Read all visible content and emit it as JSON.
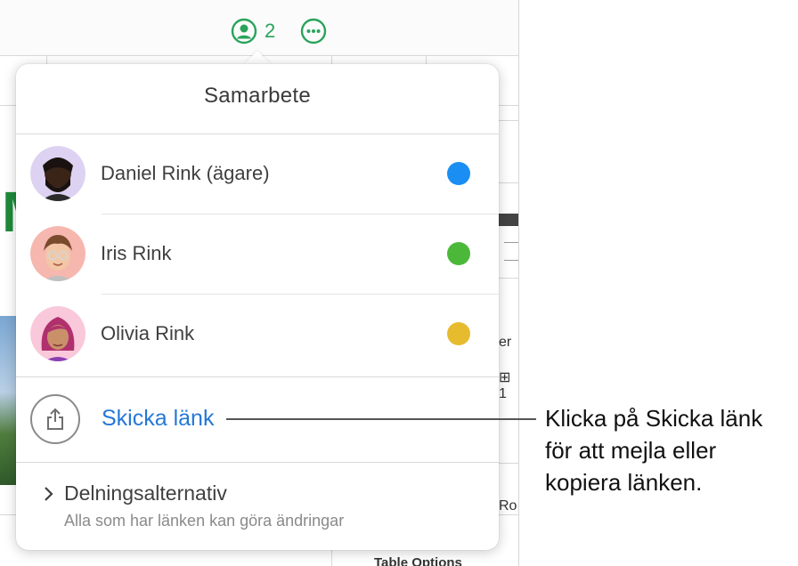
{
  "toolbar": {
    "collaborators_count": "2"
  },
  "popover": {
    "title": "Samarbete",
    "participants": [
      {
        "name": "Daniel Rink (ägare)",
        "color": "#1a8ef2"
      },
      {
        "name": "Iris Rink",
        "color": "#4cb83a"
      },
      {
        "name": "Olivia Rink",
        "color": "#e6bc2e"
      }
    ],
    "send_link_label": "Skicka länk",
    "share_options": {
      "title": "Delningsalternativ",
      "subtitle": "Alla som har länken kan göra ändringar"
    }
  },
  "callout": {
    "lines": [
      "Klicka på Skicka länk",
      "för att mejla eller",
      "kopiera länken."
    ]
  },
  "background": {
    "fragments": [
      "M",
      "er",
      "⊞ 1",
      "Ro",
      "Table Options"
    ]
  }
}
